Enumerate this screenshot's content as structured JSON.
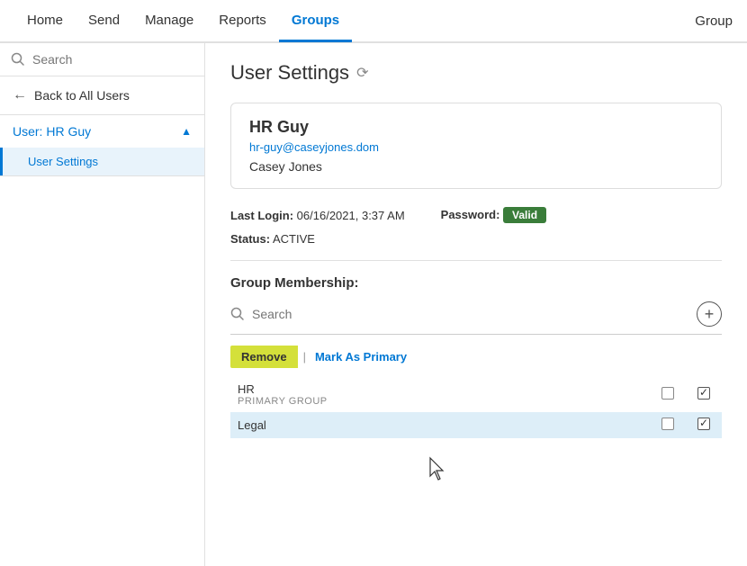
{
  "nav": {
    "items": [
      {
        "label": "Home",
        "active": false
      },
      {
        "label": "Send",
        "active": false
      },
      {
        "label": "Manage",
        "active": false
      },
      {
        "label": "Reports",
        "active": false
      },
      {
        "label": "Groups",
        "active": true
      }
    ],
    "right_label": "Group"
  },
  "sidebar": {
    "search_placeholder": "Search",
    "back_label": "Back to All Users",
    "user_label": "User: HR Guy",
    "sub_items": [
      {
        "label": "User Settings"
      }
    ]
  },
  "main": {
    "page_title": "User Settings",
    "user_card": {
      "name": "HR Guy",
      "email": "hr-guy@caseyjones.dom",
      "org": "Casey Jones"
    },
    "last_login_label": "Last Login:",
    "last_login_value": "06/16/2021, 3:37 AM",
    "password_label": "Password:",
    "password_badge": "Valid",
    "status_label": "Status:",
    "status_value": "ACTIVE",
    "group_membership_title": "Group Membership:",
    "group_search_placeholder": "Search",
    "btn_remove": "Remove",
    "btn_mark_primary": "Mark As Primary",
    "groups": [
      {
        "name": "HR",
        "sub": "PRIMARY GROUP",
        "checked1": false,
        "checked2": true,
        "highlighted": false
      },
      {
        "name": "Legal",
        "sub": "",
        "checked1": false,
        "checked2": true,
        "highlighted": true
      }
    ]
  }
}
